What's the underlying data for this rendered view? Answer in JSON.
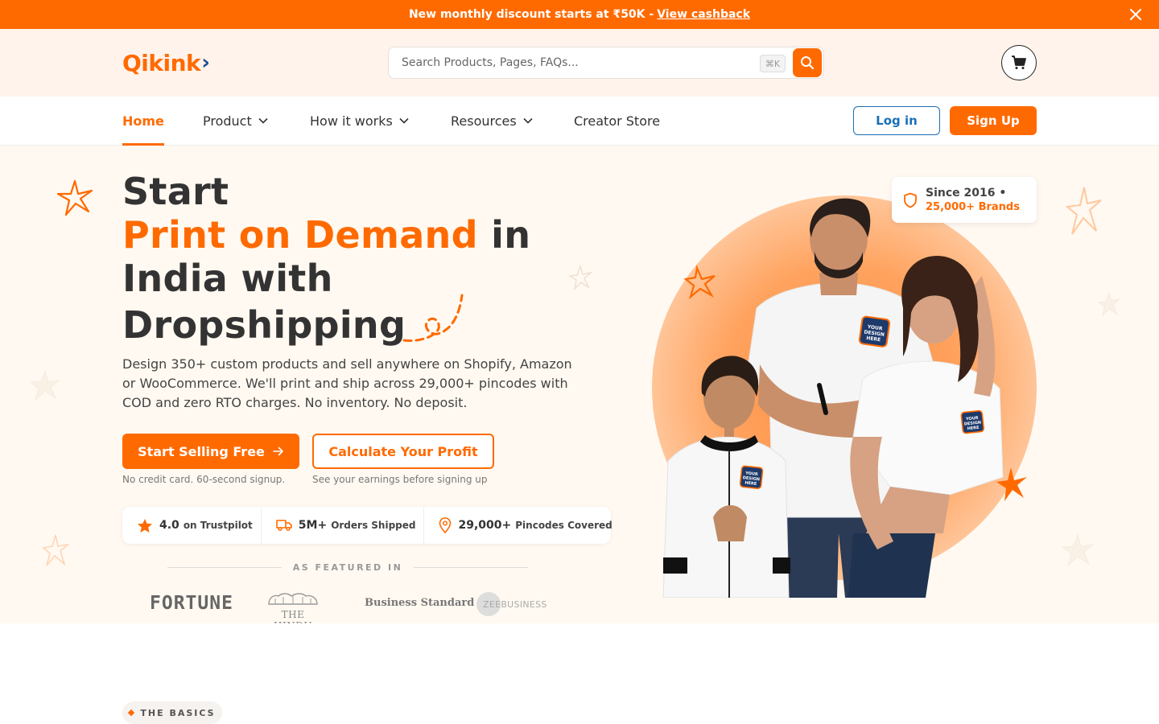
{
  "announcement": {
    "text": "New monthly discount starts at ₹50K - ",
    "link": "View cashback"
  },
  "header": {
    "logo": "Qikink",
    "search_placeholder": "Search Products, Pages, FAQs...",
    "shortcut": "⌘K"
  },
  "nav": {
    "items": [
      {
        "label": "Home"
      },
      {
        "label": "Product"
      },
      {
        "label": "How it works"
      },
      {
        "label": "Resources"
      },
      {
        "label": "Creator Store"
      }
    ],
    "login": "Log in",
    "signup": "Sign Up"
  },
  "hero": {
    "line1": "Start",
    "highlight": "Print on Demand",
    "line2_rest": "in",
    "line3": "India with",
    "line4": "Dropshipping",
    "description": "Design 350+ custom products and sell anywhere on Shopify, Amazon or WooCommerce. We'll print and ship across 29,000+ pincodes with COD and zero RTO charges. No inventory. No deposit.",
    "cta_primary": "Start Selling Free",
    "cta_primary_sub": "No credit card. 60-second signup.",
    "cta_secondary": "Calculate Your Profit",
    "cta_secondary_sub": "See your earnings before signing up",
    "stats": [
      {
        "value": "4.0",
        "label": "on Trustpilot"
      },
      {
        "value": "5M+",
        "label": "Orders Shipped"
      },
      {
        "value": "29,000+",
        "label": "Pincodes Covered"
      }
    ],
    "featured_label": "AS FEATURED IN",
    "press": [
      "FORTUNE",
      "THE HINDU",
      "Business Standard",
      "ZEEBUSINESS"
    ],
    "badge_line1": "Since 2016 •",
    "badge_line2": "25,000+ Brands",
    "tshirt_print": "YOUR DESIGN HERE"
  },
  "section": {
    "eyebrow": "THE BASICS"
  },
  "colors": {
    "brand": "#ff6a00",
    "link_blue": "#1a6fb5",
    "hero_bg": "#fff9f1",
    "header_bg": "#fff3ec"
  }
}
